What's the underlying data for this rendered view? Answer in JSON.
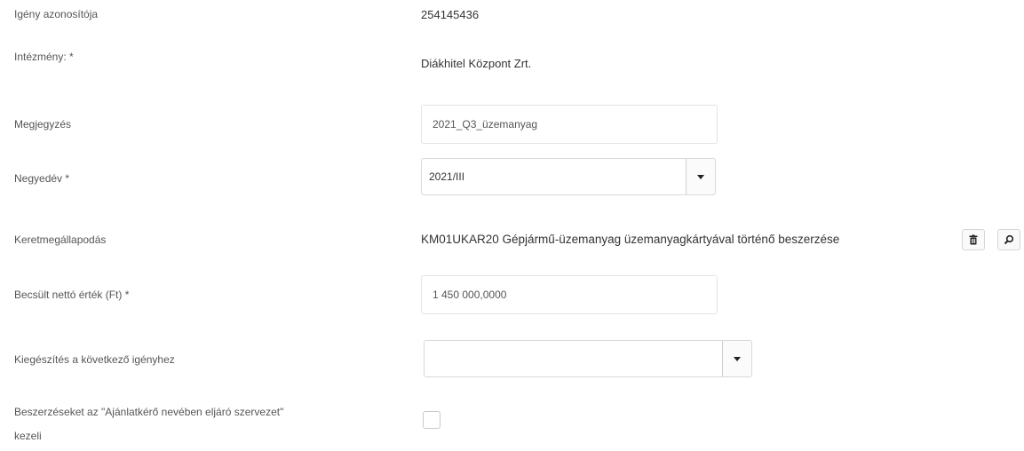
{
  "form": {
    "request_id": {
      "label": "Igény azonosítója",
      "value": "254145436"
    },
    "institution": {
      "label": "Intézmény: *",
      "value": "Diákhitel Központ Zrt."
    },
    "note": {
      "label": "Megjegyzés",
      "value": "2021_Q3_üzemanyag"
    },
    "quarter": {
      "label": "Negyedév *",
      "value": "2021/III"
    },
    "framework": {
      "label": "Keretmegállapodás",
      "value": "KM01UKAR20 Gépjármű-üzemanyag üzemanyagkártyával történő beszerzése",
      "delete_icon": "trash-icon",
      "search_icon": "search-icon"
    },
    "net_value": {
      "label": "Becsült nettó érték (Ft) *",
      "value": "1 450 000,0000"
    },
    "supplement": {
      "label": "Kiegészítés a következő igényhez",
      "value": ""
    },
    "handled_by_org": {
      "label_line1": "Beszerzéseket az \"Ajánlatkérő nevében eljáró szervezet\"",
      "label_line2": "kezeli",
      "checked": false
    }
  }
}
